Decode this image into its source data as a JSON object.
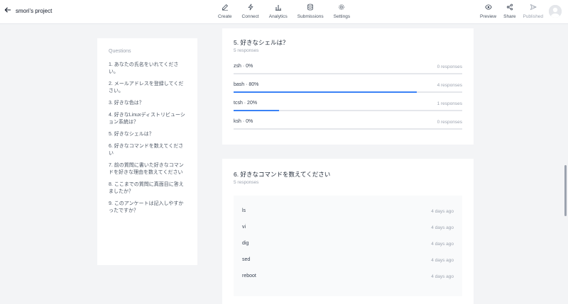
{
  "header": {
    "project_title": "smori's project",
    "nav": [
      "Create",
      "Connect",
      "Analytics",
      "Submissions",
      "Settings"
    ],
    "actions": [
      "Preview",
      "Share",
      "Published"
    ]
  },
  "sidebar": {
    "title": "Questions",
    "items": [
      "1. あなたの氏名をいれてください。",
      "2. メールアドレスを登録してください。",
      "3. 好きな色は？",
      "4. 好きなLinuxディストリビューション系統は？",
      "5. 好きなシェルは？",
      "6. 好きなコマンドを数えてください",
      "7. 前の質問に書いた好きなコマンドを好きな理由を数えてください",
      "8. ここまでの質問に真面目に答えましたか？",
      "9. このアンケートは記入しやすかったですか？"
    ]
  },
  "q5": {
    "title": "5. 好きなシェルは？",
    "responses": "5 responses",
    "options": [
      {
        "label": "zsh · 0%",
        "count": "0 responses",
        "fraction": 0
      },
      {
        "label": "bash · 80%",
        "count": "4 responses",
        "fraction": 0.8
      },
      {
        "label": "tcsh · 20%",
        "count": "1 responses",
        "fraction": 0.2
      },
      {
        "label": "ksh · 0%",
        "count": "0 responses",
        "fraction": 0
      }
    ]
  },
  "q6": {
    "title": "6. 好きなコマンドを数えてください",
    "responses": "5 responses",
    "rows": [
      {
        "text": "ls",
        "time": "4 days ago"
      },
      {
        "text": "vi",
        "time": "4 days ago"
      },
      {
        "text": "dig",
        "time": "4 days ago"
      },
      {
        "text": "sed",
        "time": "4 days ago"
      },
      {
        "text": "reboot",
        "time": "4 days ago"
      }
    ]
  },
  "colors": {
    "accent": "#3b82f6"
  }
}
